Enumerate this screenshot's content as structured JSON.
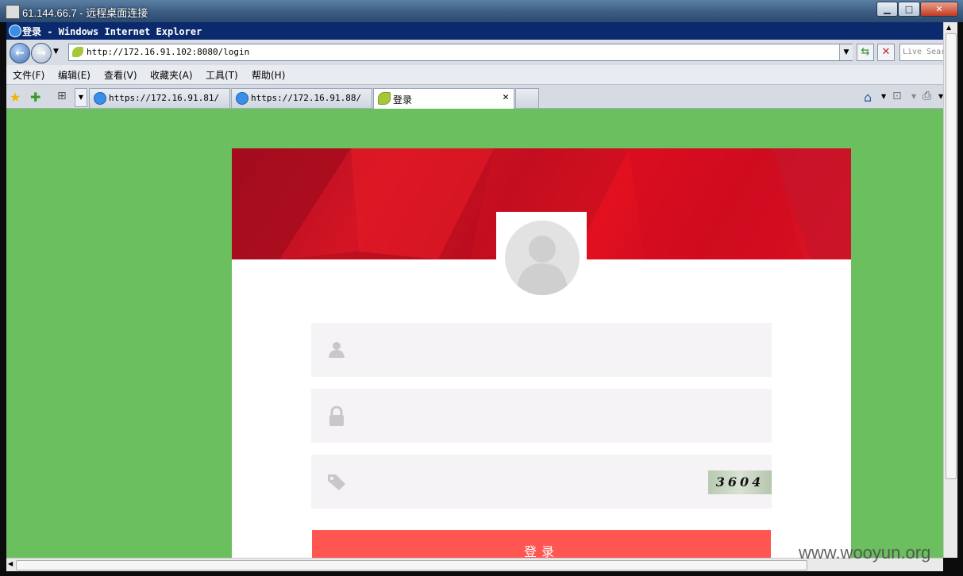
{
  "rdp": {
    "title": "61.144.66.7 - 远程桌面连接",
    "btn_min": "▁",
    "btn_max": "□",
    "btn_close": "✕"
  },
  "ie": {
    "title": "登录 - Windows Internet Explorer",
    "url": "http://172.16.91.102:8080/login",
    "search_placeholder": "Live Sear",
    "menu": [
      "文件(F)",
      "编辑(E)",
      "查看(V)",
      "收藏夹(A)",
      "工具(T)",
      "帮助(H)"
    ],
    "tabs": [
      {
        "label": "https://172.16.91.81/"
      },
      {
        "label": "https://172.16.91.88/"
      },
      {
        "label": "登录",
        "close": "✕"
      }
    ]
  },
  "login": {
    "captcha": "3604",
    "button": "登录"
  },
  "colors": {
    "page_bg": "#6bbf5f",
    "banner": "#d41425",
    "button": "#ff5651",
    "field_bg": "#f5f3f6"
  },
  "watermark": "www.wooyun.org"
}
